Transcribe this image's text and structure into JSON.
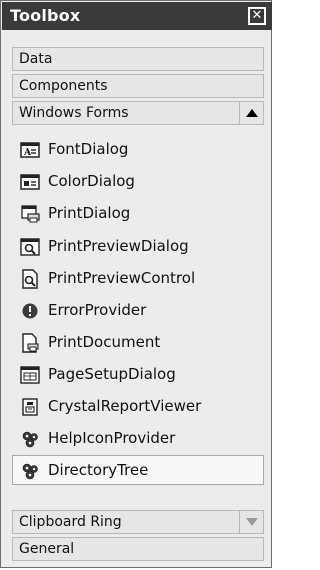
{
  "window": {
    "title": "Toolbox"
  },
  "categories": {
    "data": {
      "label": "Data"
    },
    "components": {
      "label": "Components"
    },
    "windows_forms": {
      "label": "Windows Forms"
    },
    "clipboard_ring": {
      "label": "Clipboard Ring"
    },
    "general": {
      "label": "General"
    }
  },
  "windows_forms_items": [
    {
      "label": "FontDialog",
      "icon": "font-dialog-icon"
    },
    {
      "label": "ColorDialog",
      "icon": "color-dialog-icon"
    },
    {
      "label": "PrintDialog",
      "icon": "print-dialog-icon"
    },
    {
      "label": "PrintPreviewDialog",
      "icon": "print-preview-dialog-icon"
    },
    {
      "label": "PrintPreviewControl",
      "icon": "print-preview-control-icon"
    },
    {
      "label": "ErrorProvider",
      "icon": "error-provider-icon"
    },
    {
      "label": "PrintDocument",
      "icon": "print-document-icon"
    },
    {
      "label": "PageSetupDialog",
      "icon": "page-setup-dialog-icon"
    },
    {
      "label": "CrystalReportViewer",
      "icon": "crystal-report-viewer-icon"
    },
    {
      "label": "HelpIconProvider",
      "icon": "help-icon-provider-icon"
    },
    {
      "label": "DirectoryTree",
      "icon": "directory-tree-icon"
    }
  ]
}
